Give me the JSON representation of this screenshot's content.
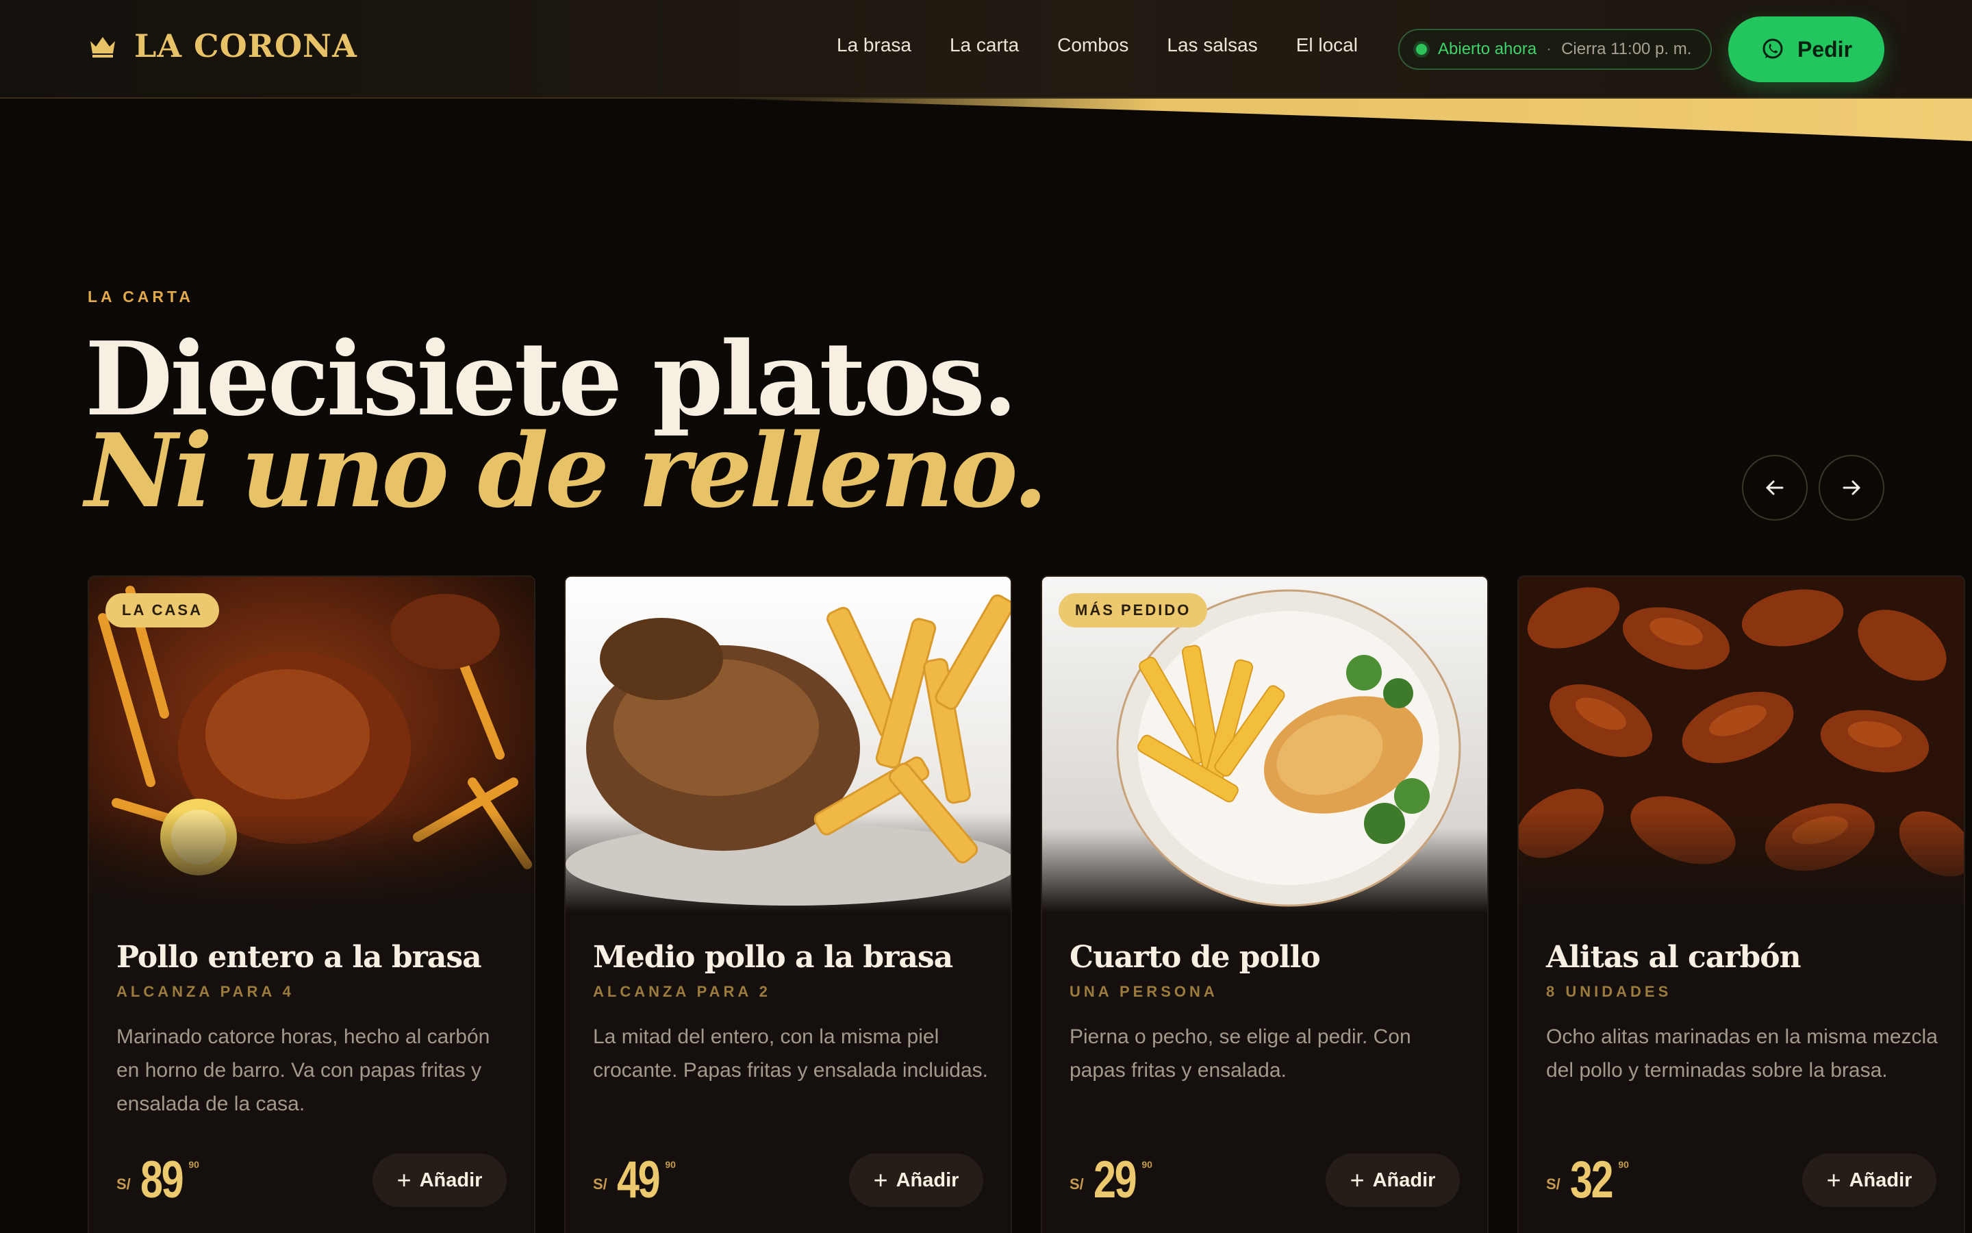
{
  "header": {
    "brand": "LA CORONA",
    "nav": [
      "La brasa",
      "La carta",
      "Combos",
      "Las salsas",
      "El local"
    ],
    "status_open": "Abierto ahora",
    "status_sep": "·",
    "status_close": "Cierra 11:00 p. m.",
    "order_label": "Pedir"
  },
  "section": {
    "eyebrow": "LA CARTA",
    "title_line1": "Diecisiete platos.",
    "title_line2": "Ni uno de relleno."
  },
  "cards": [
    {
      "badge": "LA CASA",
      "title": "Pollo entero a la brasa",
      "subtitle": "ALCANZA PARA 4",
      "description": "Marinado catorce horas, hecho al carbón en horno de barro. Va con papas fritas y ensalada de la casa.",
      "currency": "S/",
      "price": "89",
      "cents": "90",
      "add_label": "Añadir"
    },
    {
      "badge": "",
      "title": "Medio pollo a la brasa",
      "subtitle": "ALCANZA PARA 2",
      "description": "La mitad del entero, con la misma piel crocante. Papas fritas y ensalada incluidas.",
      "currency": "S/",
      "price": "49",
      "cents": "90",
      "add_label": "Añadir"
    },
    {
      "badge": "MÁS PEDIDO",
      "title": "Cuarto de pollo",
      "subtitle": "UNA PERSONA",
      "description": "Pierna o pecho, se elige al pedir. Con papas fritas y ensalada.",
      "currency": "S/",
      "price": "29",
      "cents": "90",
      "add_label": "Añadir"
    },
    {
      "badge": "",
      "title": "Alitas al carbón",
      "subtitle": "8 UNIDADES",
      "description": "Ocho alitas marinadas en la misma mezcla del pollo y terminadas sobre la brasa.",
      "currency": "S/",
      "price": "32",
      "cents": "90",
      "add_label": "Añadir"
    }
  ],
  "icons": {
    "logo": "crown-icon",
    "order": "whatsapp-icon",
    "prev": "arrow-left-icon",
    "next": "arrow-right-icon",
    "add": "plus-icon"
  },
  "colors": {
    "background": "#0b0806",
    "gold": "#e8c266",
    "green": "#22c55e",
    "card": "#15100d"
  }
}
